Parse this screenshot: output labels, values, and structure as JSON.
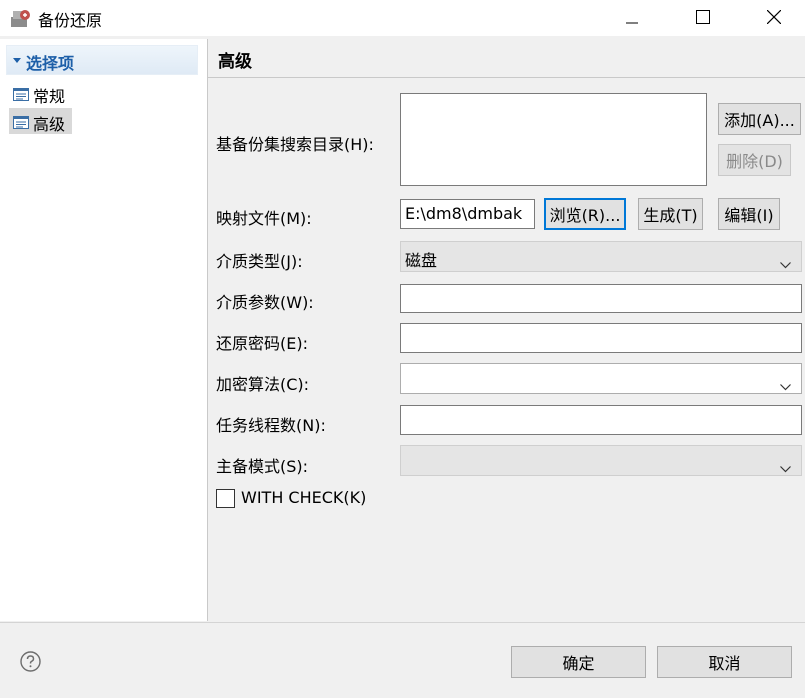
{
  "window": {
    "title": "备份还原"
  },
  "sidebar": {
    "root": {
      "label": "选择项"
    },
    "items": [
      {
        "label": "常规"
      },
      {
        "label": "高级"
      }
    ]
  },
  "main": {
    "title": "高级",
    "base_dir": {
      "label": "基备份集搜索目录(H):",
      "add_label": "添加(A)...",
      "delete_label": "删除(D)"
    },
    "map_file": {
      "label": "映射文件(M):",
      "value": "E:\\dm8\\dmbak",
      "browse_label": "浏览(R)...",
      "generate_label": "生成(T)",
      "edit_label": "编辑(I)"
    },
    "media_type": {
      "label": "介质类型(J):",
      "value": "磁盘"
    },
    "media_params": {
      "label": "介质参数(W):",
      "value": ""
    },
    "restore_password": {
      "label": "还原密码(E):",
      "value": ""
    },
    "encrypt_algo": {
      "label": "加密算法(C):",
      "value": ""
    },
    "task_threads": {
      "label": "任务线程数(N):",
      "value": ""
    },
    "primary_mode": {
      "label": "主备模式(S):",
      "value": ""
    },
    "with_check": {
      "label": "WITH CHECK(K)",
      "checked": false
    }
  },
  "footer": {
    "ok_label": "确定",
    "cancel_label": "取消"
  }
}
